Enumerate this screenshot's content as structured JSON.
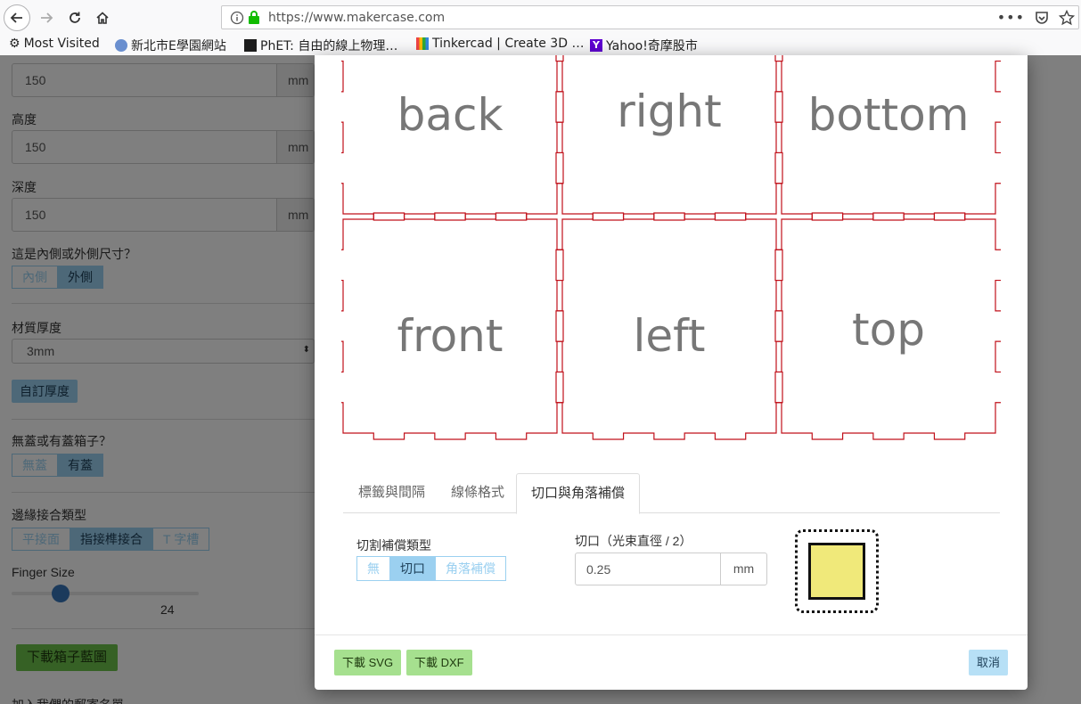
{
  "browser": {
    "url": "https://www.makercase.com",
    "bookmarks": [
      {
        "label": "Most Visited",
        "icon": "gear-icon"
      },
      {
        "label": "新北市E學園網站",
        "icon": "globe-icon"
      },
      {
        "label": "PhET: 自由的線上物理…",
        "icon": "phet-icon"
      },
      {
        "label": "Tinkercad | Create 3D …",
        "icon": "tinkercad-icon"
      },
      {
        "label": "Yahoo!奇摩股市",
        "icon": "yahoo-icon"
      }
    ]
  },
  "sidebar": {
    "width": {
      "value": "150",
      "unit": "mm"
    },
    "height": {
      "label": "高度",
      "value": "150",
      "unit": "mm"
    },
    "depth": {
      "label": "深度",
      "value": "150",
      "unit": "mm"
    },
    "dimension_type": {
      "label": "這是內側或外側尺寸？",
      "options": [
        "內側",
        "外側"
      ],
      "selected": "外側"
    },
    "material": {
      "label": "材質厚度",
      "value": "3mm"
    },
    "custom_thickness_label": "自訂厚度",
    "lid": {
      "label": "無蓋或有蓋箱子？",
      "options": [
        "無蓋",
        "有蓋"
      ],
      "selected": "有蓋"
    },
    "edge_joints": {
      "label": "邊緣接合類型",
      "options": [
        "平接面",
        "指接榫接合",
        "T 字槽"
      ],
      "selected": "指接榫接合"
    },
    "finger_size": {
      "label": "Finger Size",
      "value": "24",
      "fraction": 0.26
    },
    "download_plan_label": "下載箱子藍圖",
    "bottom_text": "加入我們的郵寄名單"
  },
  "modal": {
    "panels": [
      "back",
      "right",
      "bottom",
      "front",
      "left",
      "top"
    ],
    "tabs": [
      "標籤與間隔",
      "線條格式",
      "切口與角落補償"
    ],
    "active_tab": "切口與角落補償",
    "kerf_type": {
      "label": "切割補償類型",
      "options": [
        "無",
        "切口",
        "角落補償"
      ],
      "selected": "切口"
    },
    "kerf": {
      "label": "切口（光束直徑 / 2）",
      "value": "0.25",
      "unit": "mm"
    },
    "footer": {
      "svg_label": "下載 SVG",
      "dxf_label": "下載 DXF",
      "cancel_label": "取消"
    },
    "colors": {
      "cut_line": "#c0101a",
      "preview_fill": "#f0e97a",
      "download_btn": "#a6e08f",
      "cancel_btn": "#b7e0f6"
    }
  }
}
